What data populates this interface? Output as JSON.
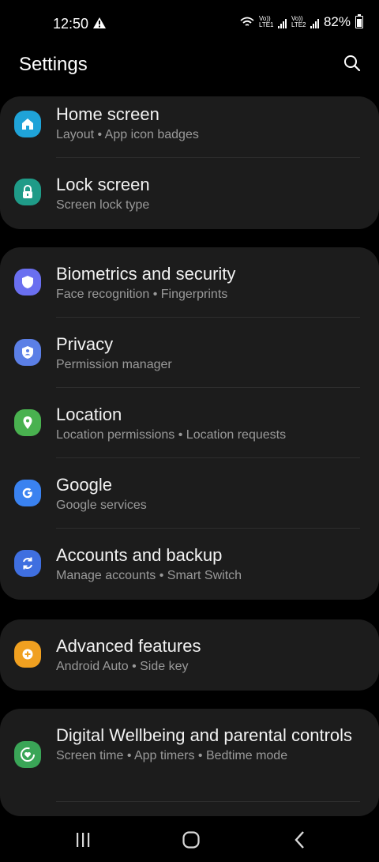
{
  "status_bar": {
    "time": "12:50",
    "lte1": "Vo)) LTE1",
    "lte2": "Vo)) LTE2",
    "battery": "82%"
  },
  "header": {
    "title": "Settings"
  },
  "groups": [
    {
      "items": [
        {
          "label": "Home screen",
          "sub": "Layout  •  App icon badges",
          "icon": "home-icon",
          "color": "#1fa3d8"
        },
        {
          "label": "Lock screen",
          "sub": "Screen lock type",
          "icon": "lock-icon",
          "color": "#1f9b88"
        }
      ]
    },
    {
      "items": [
        {
          "label": "Biometrics and security",
          "sub": "Face recognition  •  Fingerprints",
          "icon": "shield-icon",
          "color": "#6a6ff0"
        },
        {
          "label": "Privacy",
          "sub": "Permission manager",
          "icon": "privacy-shield-icon",
          "color": "#5b7fe6"
        },
        {
          "label": "Location",
          "sub": "Location permissions  •  Location requests",
          "icon": "location-pin-icon",
          "color": "#49b14f"
        },
        {
          "label": "Google",
          "sub": "Google services",
          "icon": "google-icon",
          "color": "#3a82f0"
        },
        {
          "label": "Accounts and backup",
          "sub": "Manage accounts  •  Smart Switch",
          "icon": "sync-icon",
          "color": "#3f6fe0"
        }
      ]
    },
    {
      "items": [
        {
          "label": "Advanced features",
          "sub": "Android Auto  •  Side key",
          "icon": "plus-gear-icon",
          "color": "#f0a020"
        }
      ]
    },
    {
      "items": [
        {
          "label": "Digital Wellbeing and parental controls",
          "sub": "Screen time  •  App timers  •  Bedtime mode",
          "icon": "wellbeing-heart-icon",
          "color": "#3aa557"
        }
      ]
    }
  ],
  "nav_bar": {
    "recents": "recents-icon",
    "home": "home-button-icon",
    "back": "back-icon"
  }
}
